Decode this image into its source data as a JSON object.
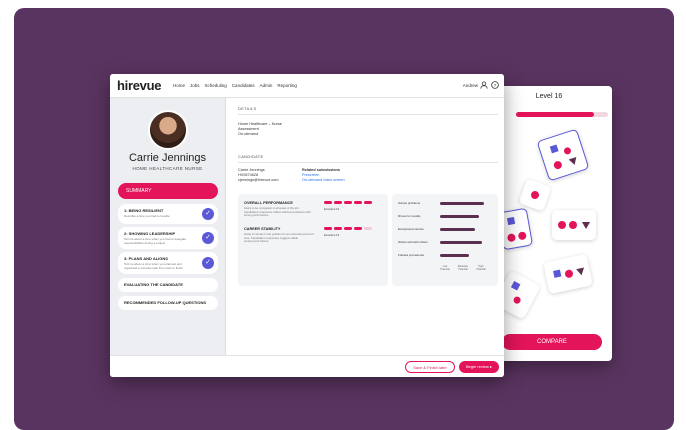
{
  "game": {
    "level": "Level 16",
    "progress": 0.85,
    "compare": "COMPARE"
  },
  "app": {
    "logo": "hirevue",
    "nav": [
      "Home",
      "Jobs",
      "Scheduling",
      "Candidates",
      "Admin",
      "Reporting"
    ],
    "user": "Andrew"
  },
  "candidate": {
    "name": "Carrie Jennings",
    "role": "HOME HEALTHCARE NURSE"
  },
  "sidebar": {
    "summary": "SUMMARY",
    "items": [
      {
        "title": "1: BEING RESILIENT",
        "sub": "Describe a time you had to handle"
      },
      {
        "title": "2: SHOWING LEADERSHIP",
        "sub": "Tell me about a time when you had to delegate responsibilities during a project"
      },
      {
        "title": "3: PLANS AND ALIGNS",
        "sub": "Tell me about a time when you planned and organized a complex task from start to finish"
      }
    ],
    "evaluating": "EVALUATING THE CANDIDATE",
    "followup": "RECOMMENDED FOLLOW-UP QUESTIONS"
  },
  "details": {
    "heading": "DETAILS",
    "lines": [
      "Home Healthcare – Nurse",
      "Assessment",
      "On-demand"
    ]
  },
  "cand_section": {
    "heading": "CANDIDATE",
    "lines": [
      "Carrie Jennings",
      "HV0874628",
      "cjennings@hirevue.com"
    ],
    "related_heading": "Related submissions",
    "related_links": [
      "Prescreen",
      "On-demand video screen"
    ]
  },
  "performance": [
    {
      "title": "OVERALL PERFORMANCE",
      "desc": "Likely to be competent in all areas of the job. Candidate's responses reflect effective behaviors with strong performance.",
      "rating": "Excellent Fit",
      "level": 5
    },
    {
      "title": "CAREER STABILITY",
      "desc": "Likely to remain in the position for an extended period of time. Candidate's responses suggest stable employment history.",
      "rating": "Excellent Fit",
      "level": 4
    }
  ],
  "scales": {
    "rows": [
      {
        "label": "Solves problems",
        "value": 0.85
      },
      {
        "label": "Drives for results",
        "value": 0.75
      },
      {
        "label": "Exceptional service",
        "value": 0.68
      },
      {
        "label": "Works well with others",
        "value": 0.8
      },
      {
        "label": "Follows procedures",
        "value": 0.55
      }
    ],
    "footer": [
      "Low Potential",
      "Moderate Potential",
      "High Potential"
    ]
  },
  "actions": {
    "save": "Save & Finish later",
    "begin": "Begin review ▸"
  }
}
